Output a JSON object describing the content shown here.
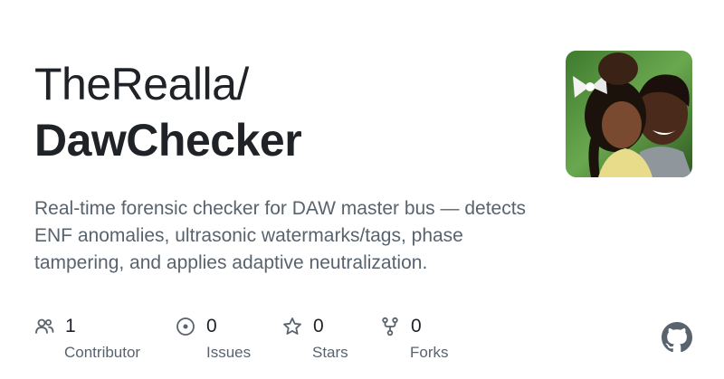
{
  "repo": {
    "owner": "TheRealla/",
    "name": "DawChecker",
    "description": "Real-time forensic checker for DAW master bus — detects ENF anomalies, ultrasonic watermarks/tags, phase tampering, and applies adaptive neutralization."
  },
  "stats": [
    {
      "icon": "people-icon",
      "count": "1",
      "label": "Contributor"
    },
    {
      "icon": "issue-icon",
      "count": "0",
      "label": "Issues"
    },
    {
      "icon": "star-icon",
      "count": "0",
      "label": "Stars"
    },
    {
      "icon": "fork-icon",
      "count": "0",
      "label": "Forks"
    }
  ],
  "colors": {
    "text_primary": "#1f2328",
    "text_secondary": "#59636e",
    "icon": "#59636e"
  }
}
